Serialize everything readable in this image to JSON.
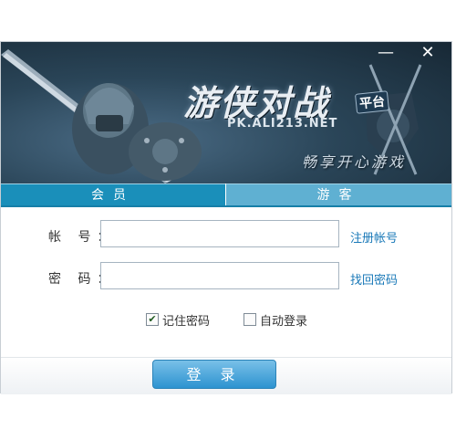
{
  "banner": {
    "logo_title": "游侠对战",
    "logo_badge": "平台",
    "logo_url": "PK.ALI213.NET",
    "slogan": "畅享开心游戏"
  },
  "window_controls": {
    "minimize": "—",
    "close": "✕"
  },
  "tabs": [
    {
      "label": "会员",
      "active": true
    },
    {
      "label": "游客",
      "active": false
    }
  ],
  "form": {
    "account_label": "帐 号：",
    "account_value": "",
    "password_label": "密 码：",
    "password_value": "",
    "register_link": "注册帐号",
    "recover_link": "找回密码",
    "remember_password": {
      "label": "记住密码",
      "checked": true
    },
    "auto_login": {
      "label": "自动登录",
      "checked": false
    },
    "login_button": "登 录"
  },
  "colors": {
    "tab_active": "#1a8fba",
    "tab_inactive": "#5fb0d2",
    "link": "#1a79b8",
    "button": "#2d93d0"
  }
}
